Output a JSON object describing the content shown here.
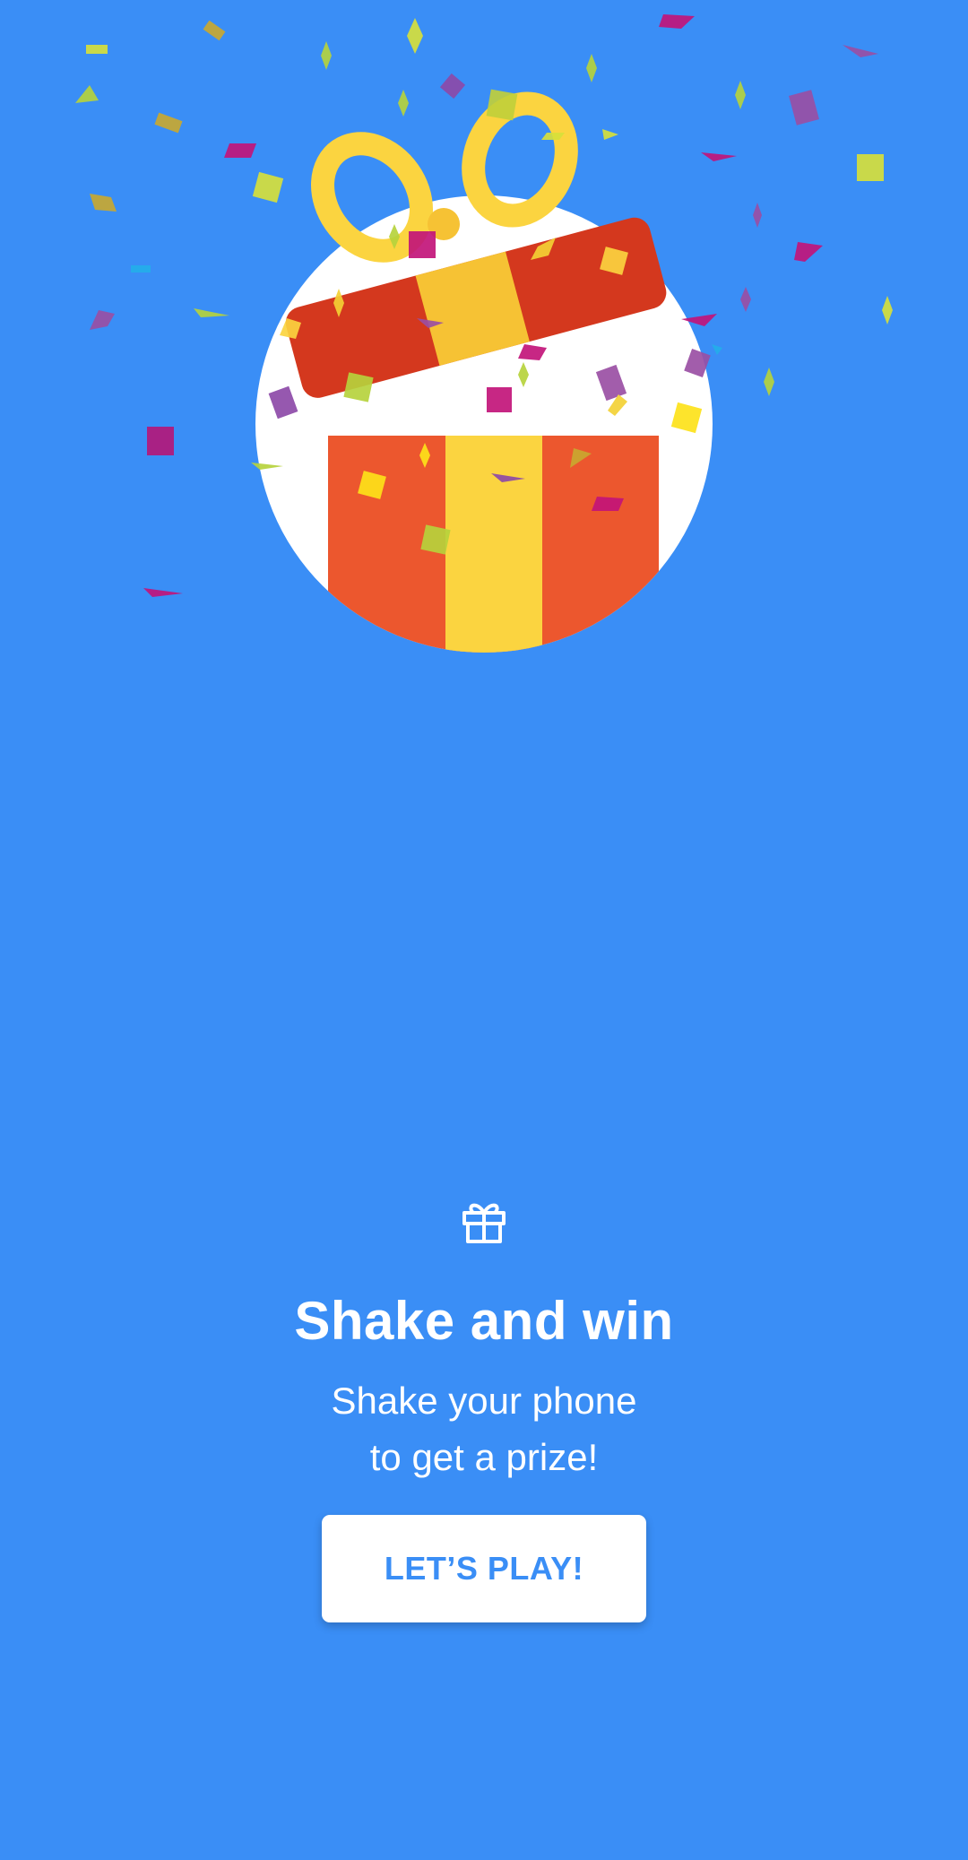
{
  "hero": {
    "illustration": "open-gift-box-with-confetti",
    "colors": {
      "background": "#3a8ef6",
      "circle": "#ffffff",
      "box": "#ec572e",
      "lid": "#d4381e",
      "ribbon": "#fbd440",
      "bow": "#fbd440"
    }
  },
  "intro": {
    "icon": "gift-icon",
    "title": "Shake and win",
    "subtitle_line1": "Shake your phone",
    "subtitle_line2": "to get a prize!"
  },
  "cta": {
    "label": "LET’S PLAY!"
  }
}
